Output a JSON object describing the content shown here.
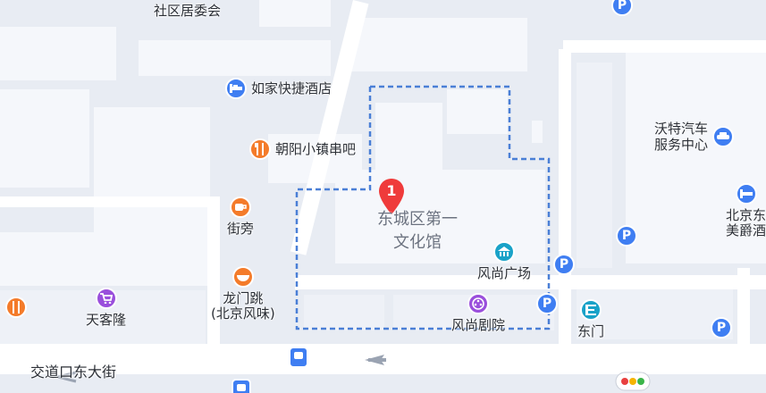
{
  "map": {
    "area_label_line1": "东城区第一",
    "area_label_line2": "文化馆",
    "marker_number": "1",
    "street_name": "交道口东大街",
    "colors": {
      "outline": "#4a7fd6",
      "marker": "#ef3b3b",
      "parking": "#3f7ef2"
    }
  },
  "pois": {
    "shequ": {
      "label": "社区居委会"
    },
    "rujia": {
      "label": "如家快捷酒店",
      "icon": "bed-icon"
    },
    "chaoyang": {
      "label": "朝阳小镇串吧",
      "icon": "fork-knife-icon"
    },
    "jiepang": {
      "label": "街旁",
      "icon": "coffee-cup-icon"
    },
    "longmen_line1": "龙门跳",
    "longmen_line2": "(北京风味)",
    "tiankelong": {
      "label": "天客隆",
      "icon": "shopping-cart-icon"
    },
    "fengshang_plaza": {
      "label": "风尚广场",
      "icon": "building-icon"
    },
    "fengshang_theater": {
      "label": "风尚剧院",
      "icon": "film-reel-icon"
    },
    "wote_line1": "沃特汽车",
    "wote_line2": "服务中心",
    "beijing_hotel_line1": "北京东",
    "beijing_hotel_line2": "美爵酒",
    "dongmen": {
      "label": "东门",
      "icon": "gate-icon"
    }
  },
  "parking_label": "P"
}
